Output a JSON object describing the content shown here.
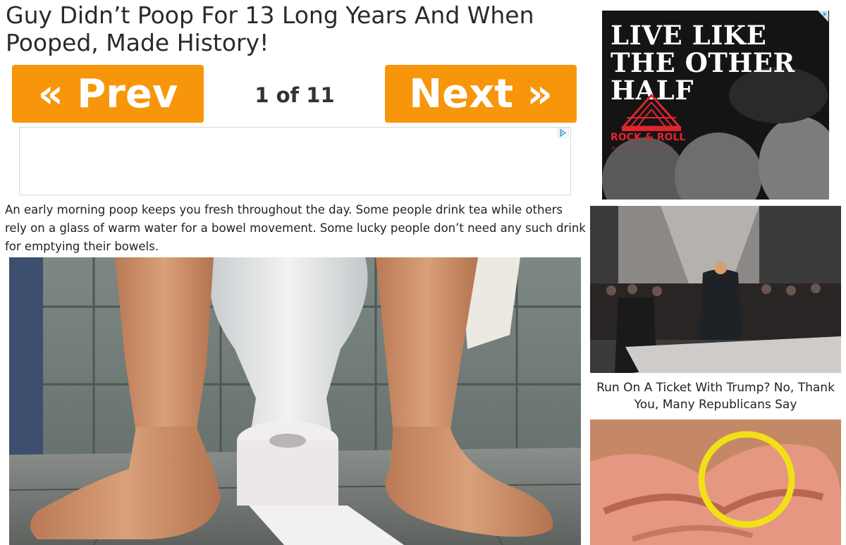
{
  "article": {
    "headline": "Guy Didn’t Poop For 13 Long Years And When Pooped, Made History!",
    "intro": "An early morning poop keeps you fresh throughout the day. Some people drink tea while others rely on a glass of warm water for a bowel movement. Some lucky people don’t need any such drink for emptying their bowels."
  },
  "pagination": {
    "prev_label": "« Prev",
    "next_label": "Next »",
    "page_indicator": "1 of 11"
  },
  "sidebar": {
    "ad": {
      "headline": "LIVE LIKE THE OTHER HALF",
      "logo_name": "ROCK & ROLL",
      "logo_subtitle": "HALL OF FAME"
    },
    "story_caption": "Run On A Ticket With Trump? No, Thank You, Many Republicans Say"
  },
  "colors": {
    "nav_button": "#f7960b",
    "ad_accent": "#e0252f",
    "adchoices": "#4aa3d9",
    "highlight_ring": "#f2e017"
  },
  "icons": {
    "adchoices": "adchoices-icon"
  }
}
